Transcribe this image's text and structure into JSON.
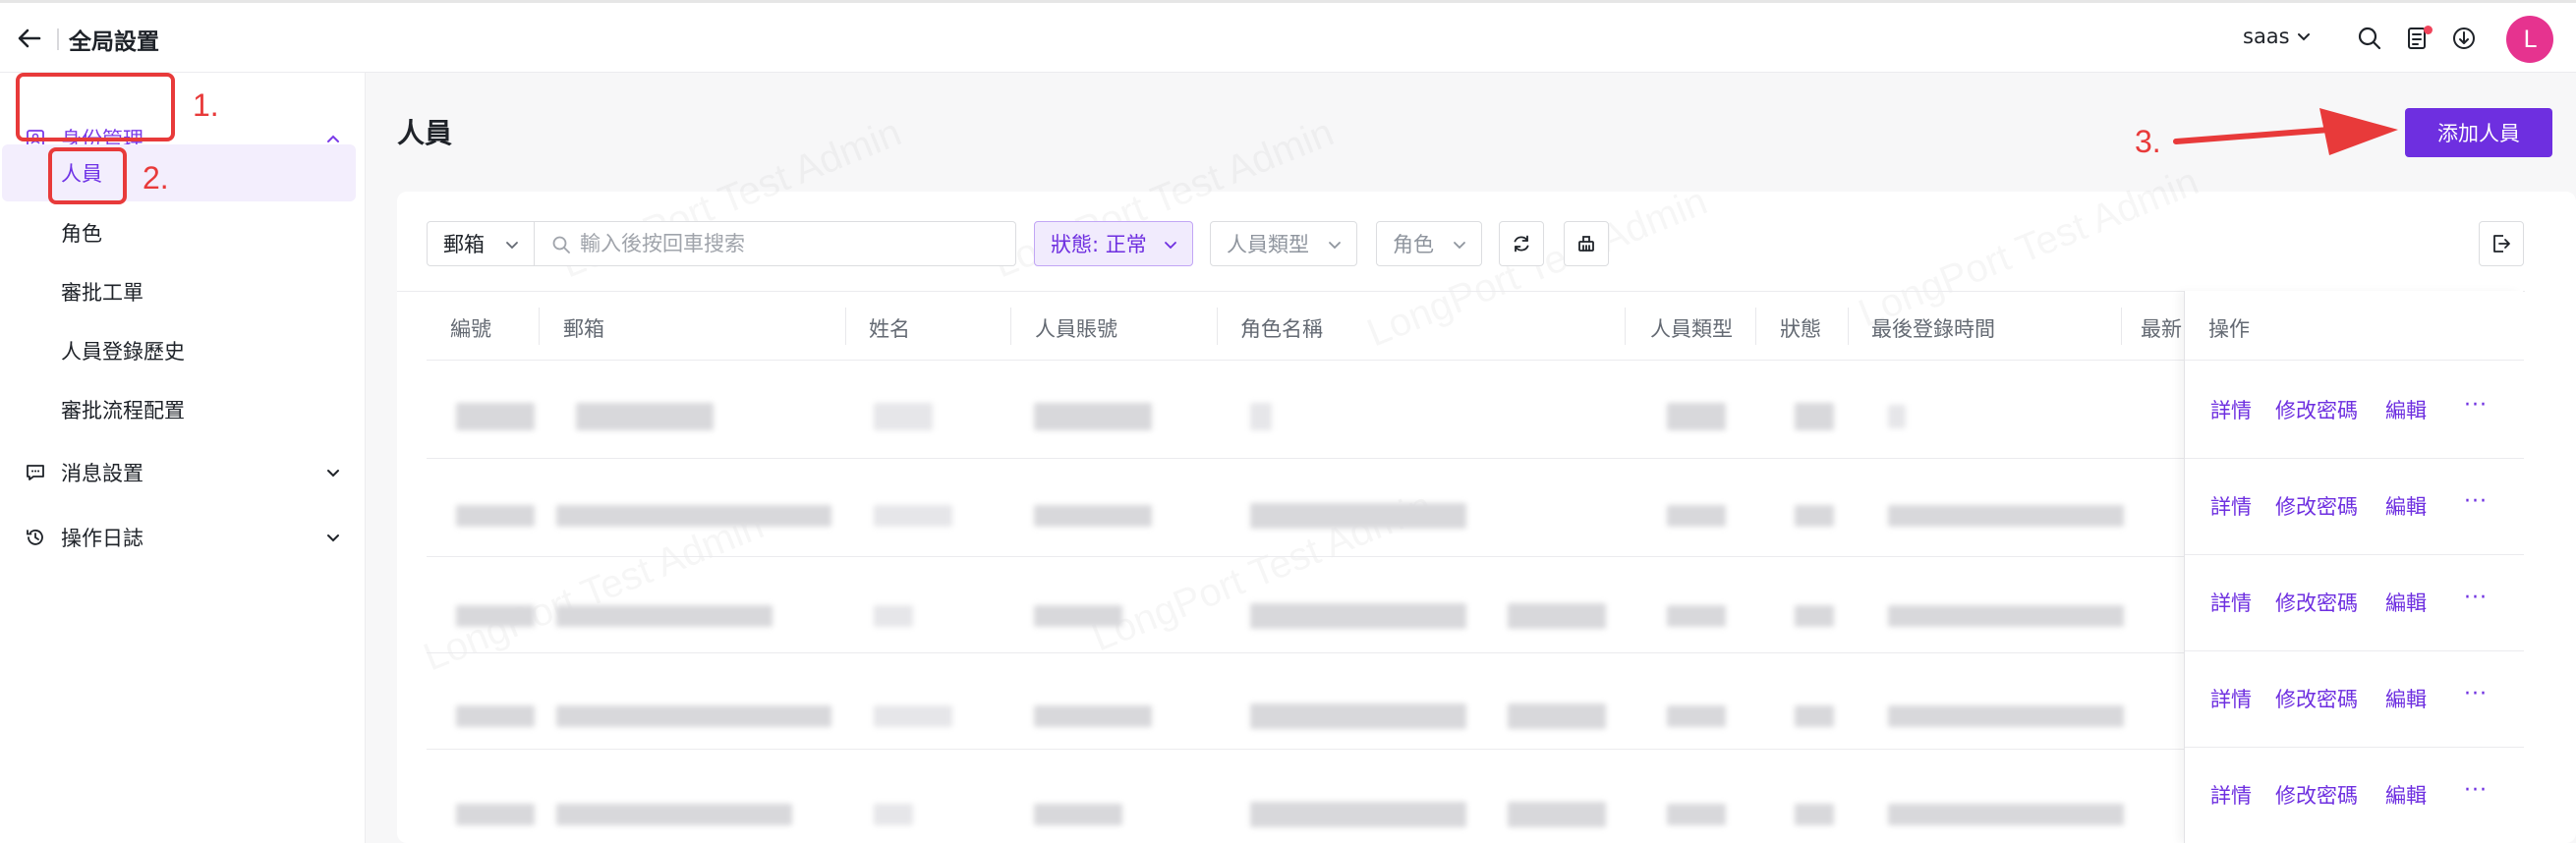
{
  "header": {
    "title": "全局設置",
    "org": "saas",
    "avatar_letter": "L"
  },
  "sidebar": {
    "groups": [
      {
        "label": "身份管理",
        "icon": "id-card-icon",
        "expanded": true,
        "items": [
          {
            "label": "人員",
            "active": true
          },
          {
            "label": "角色"
          },
          {
            "label": "審批工單"
          },
          {
            "label": "人員登錄歷史"
          },
          {
            "label": "審批流程配置"
          }
        ]
      },
      {
        "label": "消息設置",
        "icon": "message-icon",
        "expanded": false
      },
      {
        "label": "操作日誌",
        "icon": "history-icon",
        "expanded": false
      }
    ]
  },
  "main": {
    "title": "人員",
    "add_button": "添加人員",
    "filters": {
      "field_select": "郵箱",
      "search_placeholder": "輸入後按回車搜索",
      "status": "狀態: 正常",
      "type_placeholder": "人員類型",
      "role_placeholder": "角色"
    },
    "table": {
      "columns": [
        "編號",
        "郵箱",
        "姓名",
        "人員賬號",
        "角色名稱",
        "人員類型",
        "狀態",
        "最後登錄時間",
        "最新",
        "操作"
      ],
      "row_actions": [
        "詳情",
        "修改密碼",
        "編輯",
        "···"
      ]
    },
    "watermark": "LongPort Test Admin"
  },
  "annotations": {
    "labels": [
      "1.",
      "2.",
      "3."
    ],
    "color": "#e83a3a"
  },
  "colors": {
    "primary": "#6e2fe0",
    "avatar": "#e6338f"
  }
}
